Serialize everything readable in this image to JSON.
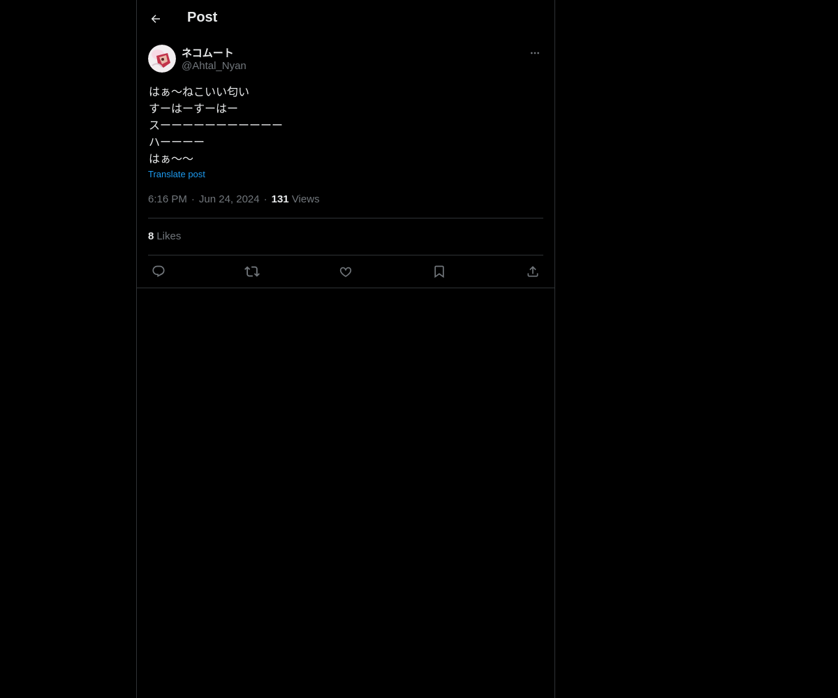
{
  "header": {
    "title": "Post",
    "back_icon": "arrow-left-icon"
  },
  "author": {
    "display_name": "ネコムート",
    "handle": "@Ahtal_Nyan",
    "avatar": "avatar-image",
    "more_icon": "more-horizontal-icon"
  },
  "post": {
    "lines": [
      "はぁ〜ねこいい匂い",
      "すーはーすーはー",
      "スーーーーーーーーーーー",
      "ハーーーー",
      "はぁ〜〜"
    ],
    "translate_label": "Translate post"
  },
  "meta": {
    "time": "6:16 PM",
    "separator": "·",
    "date": "Jun 24, 2024",
    "views_count": "131",
    "views_label": "Views"
  },
  "stats": {
    "likes_count": "8",
    "likes_label": "Likes"
  },
  "actions": [
    {
      "name": "reply-button",
      "icon": "reply-icon"
    },
    {
      "name": "repost-button",
      "icon": "repost-icon"
    },
    {
      "name": "like-button",
      "icon": "heart-icon"
    },
    {
      "name": "bookmark-button",
      "icon": "bookmark-icon"
    },
    {
      "name": "share-button",
      "icon": "share-icon"
    }
  ],
  "colors": {
    "background": "#000000",
    "text": "#e7e9ea",
    "muted": "#71767b",
    "border": "#2f3336",
    "accent": "#1d9bf0"
  }
}
